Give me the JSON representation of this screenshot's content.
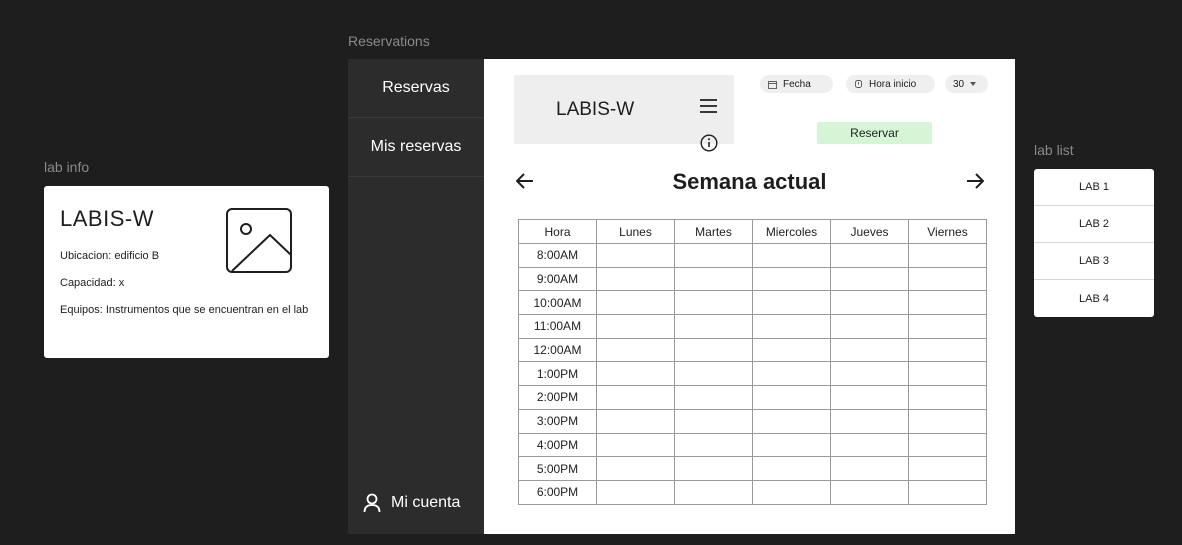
{
  "frames": {
    "lab_info_label": "lab info",
    "reservations_label": "Reservations",
    "lab_list_label": "lab list"
  },
  "lab_info": {
    "title": "LABIS-W",
    "location": "Ubicacion: edificio B",
    "capacity": "Capacidad: x",
    "equipment": "Equipos: Instrumentos que se encuentran en el lab",
    "image_icon": "image-placeholder-icon"
  },
  "sidebar": {
    "items": [
      {
        "label": "Reservas"
      },
      {
        "label": "Mis reservas"
      }
    ],
    "account_label": "Mi cuenta",
    "account_icon": "user-icon"
  },
  "header": {
    "title": "LABIS-W",
    "menu_icon": "hamburger-menu-icon",
    "info_icon": "info-icon"
  },
  "filters": {
    "date_label": "Fecha",
    "time_label": "Hora inicio",
    "duration_value": "30",
    "reserve_label": "Reservar"
  },
  "week": {
    "title": "Semana actual"
  },
  "schedule": {
    "columns": [
      "Hora",
      "Lunes",
      "Martes",
      "Miercoles",
      "Jueves",
      "Viernes"
    ],
    "rows": [
      "8:00AM",
      "9:00AM",
      "10:00AM",
      "11:00AM",
      "12:00AM",
      "1:00PM",
      "2:00PM",
      "3:00PM",
      "4:00PM",
      "5:00PM",
      "6:00PM"
    ]
  },
  "lab_list": {
    "items": [
      "LAB 1",
      "LAB 2",
      "LAB 3",
      "LAB 4"
    ]
  },
  "colors": {
    "background": "#1e1e1e",
    "sidebar": "#2c2c2c",
    "reserve_button": "#d6f5d6"
  }
}
